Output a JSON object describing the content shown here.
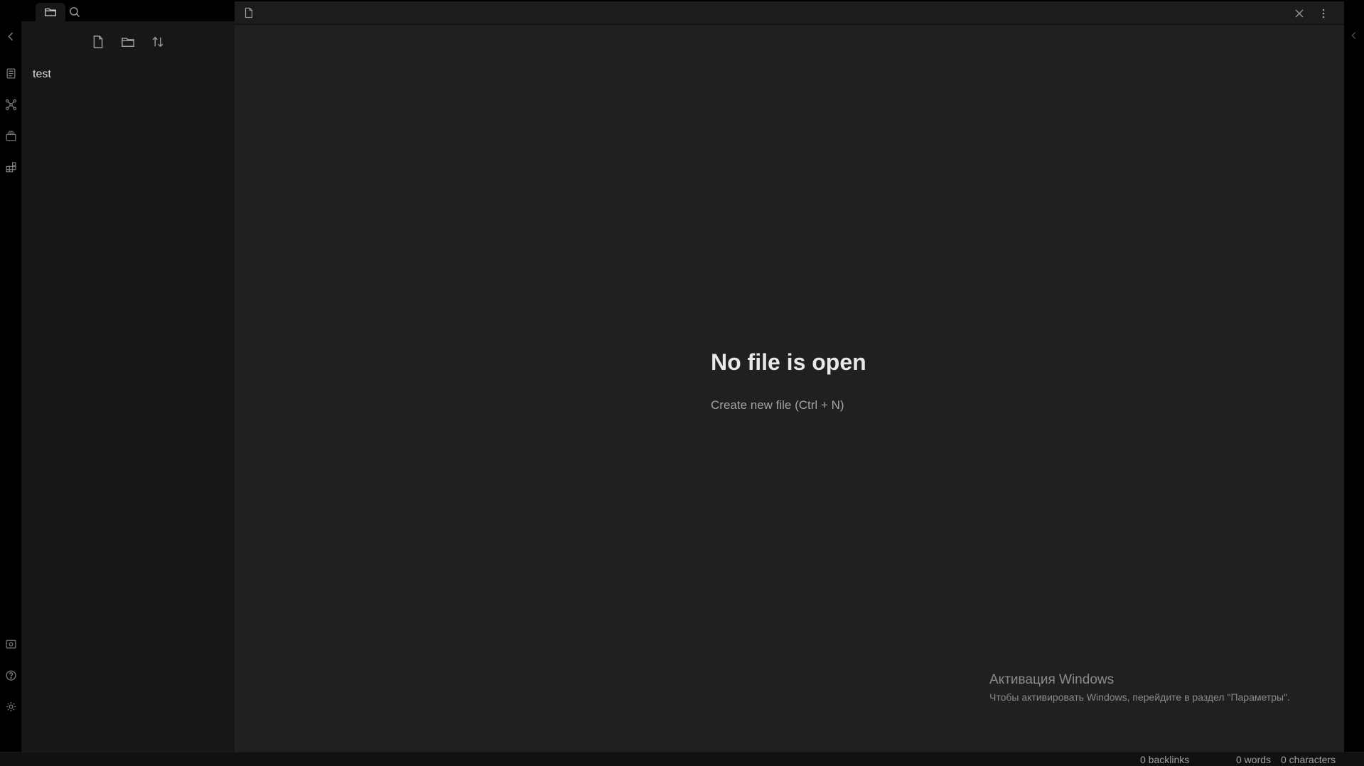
{
  "sidebar": {
    "tabs": [
      {
        "icon": "folder-icon",
        "active": true
      },
      {
        "icon": "search-icon",
        "active": false
      }
    ],
    "nav_buttons": [
      {
        "icon": "new-note-icon"
      },
      {
        "icon": "new-folder-icon"
      },
      {
        "icon": "sort-icon"
      }
    ],
    "files": [
      {
        "name": "test"
      }
    ]
  },
  "ribbon": {
    "top_icons": [
      "collapse-left-icon",
      "note-icon",
      "graph-icon",
      "cards-icon",
      "plugins-icon"
    ],
    "bottom_icons": [
      "vault-icon",
      "help-icon",
      "settings-icon"
    ]
  },
  "editor": {
    "header_icon": "file-icon",
    "empty_title": "No file is open",
    "create_action": "Create new file (Ctrl + N)"
  },
  "watermark": {
    "title": "Активация Windows",
    "subtitle": "Чтобы активировать Windows, перейдите в раздел \"Параметры\"."
  },
  "status_bar": {
    "backlinks": "0 backlinks",
    "words": "0 words",
    "characters": "0 characters"
  },
  "colors": {
    "background": "#000000",
    "sidebar": "#171717",
    "workspace": "#202020",
    "text": "#dcddde",
    "muted": "#a3a3a3"
  }
}
